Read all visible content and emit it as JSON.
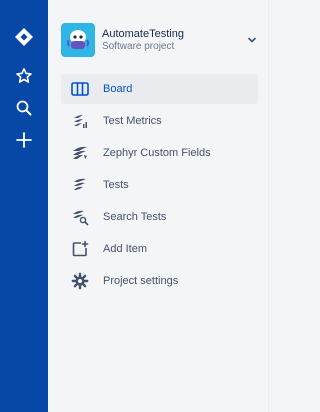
{
  "global_nav": {
    "items": [
      {
        "icon": "jira-logo-icon"
      },
      {
        "icon": "star-icon"
      },
      {
        "icon": "search-icon"
      },
      {
        "icon": "plus-icon"
      }
    ]
  },
  "project": {
    "name": "AutomateTesting",
    "type": "Software project",
    "avatar_icon": "project-avatar-icon",
    "chevron_icon": "chevron-down-icon"
  },
  "menu": {
    "items": [
      {
        "label": "Board",
        "icon": "board-icon",
        "active": true
      },
      {
        "label": "Test Metrics",
        "icon": "test-metrics-icon",
        "active": false
      },
      {
        "label": "Zephyr Custom Fields",
        "icon": "zephyr-icon",
        "active": false
      },
      {
        "label": "Tests",
        "icon": "tests-icon",
        "active": false
      },
      {
        "label": "Search Tests",
        "icon": "search-tests-icon",
        "active": false
      },
      {
        "label": "Add Item",
        "icon": "add-item-icon",
        "active": false
      },
      {
        "label": "Project settings",
        "icon": "gear-icon",
        "active": false
      }
    ]
  },
  "colors": {
    "global_nav_bg": "#0747a6",
    "sidebar_bg": "#f4f5f7",
    "active_item_bg": "#ebecf0",
    "active_text": "#0052cc",
    "text": "#42526e"
  }
}
